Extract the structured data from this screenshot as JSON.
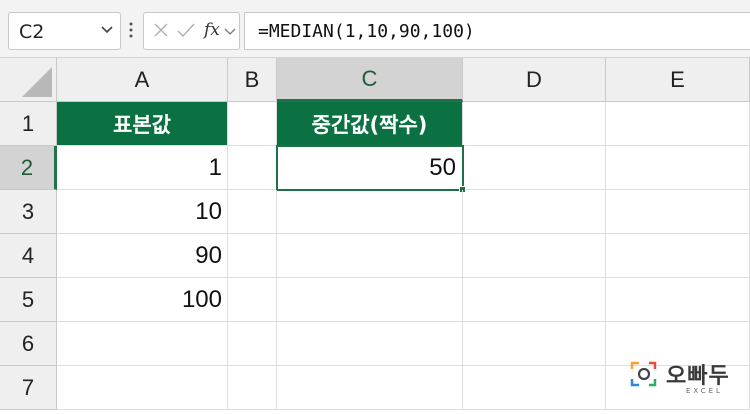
{
  "formula_bar": {
    "name_box": "C2",
    "fx_label": "fx",
    "formula": "=MEDIAN(1,10,90,100)"
  },
  "columns": [
    "A",
    "B",
    "C",
    "D",
    "E"
  ],
  "rows": [
    "1",
    "2",
    "3",
    "4",
    "5",
    "6",
    "7"
  ],
  "cells": {
    "A1": "표본값",
    "A2": "1",
    "A3": "10",
    "A4": "90",
    "A5": "100",
    "C1": "중간값(짝수)",
    "C2": "50"
  },
  "selected_cell": "C2",
  "colors": {
    "header_fill": "#0b7143",
    "selection": "#217346"
  },
  "logo": {
    "name": "오빠두",
    "sub": "EXCEL"
  }
}
